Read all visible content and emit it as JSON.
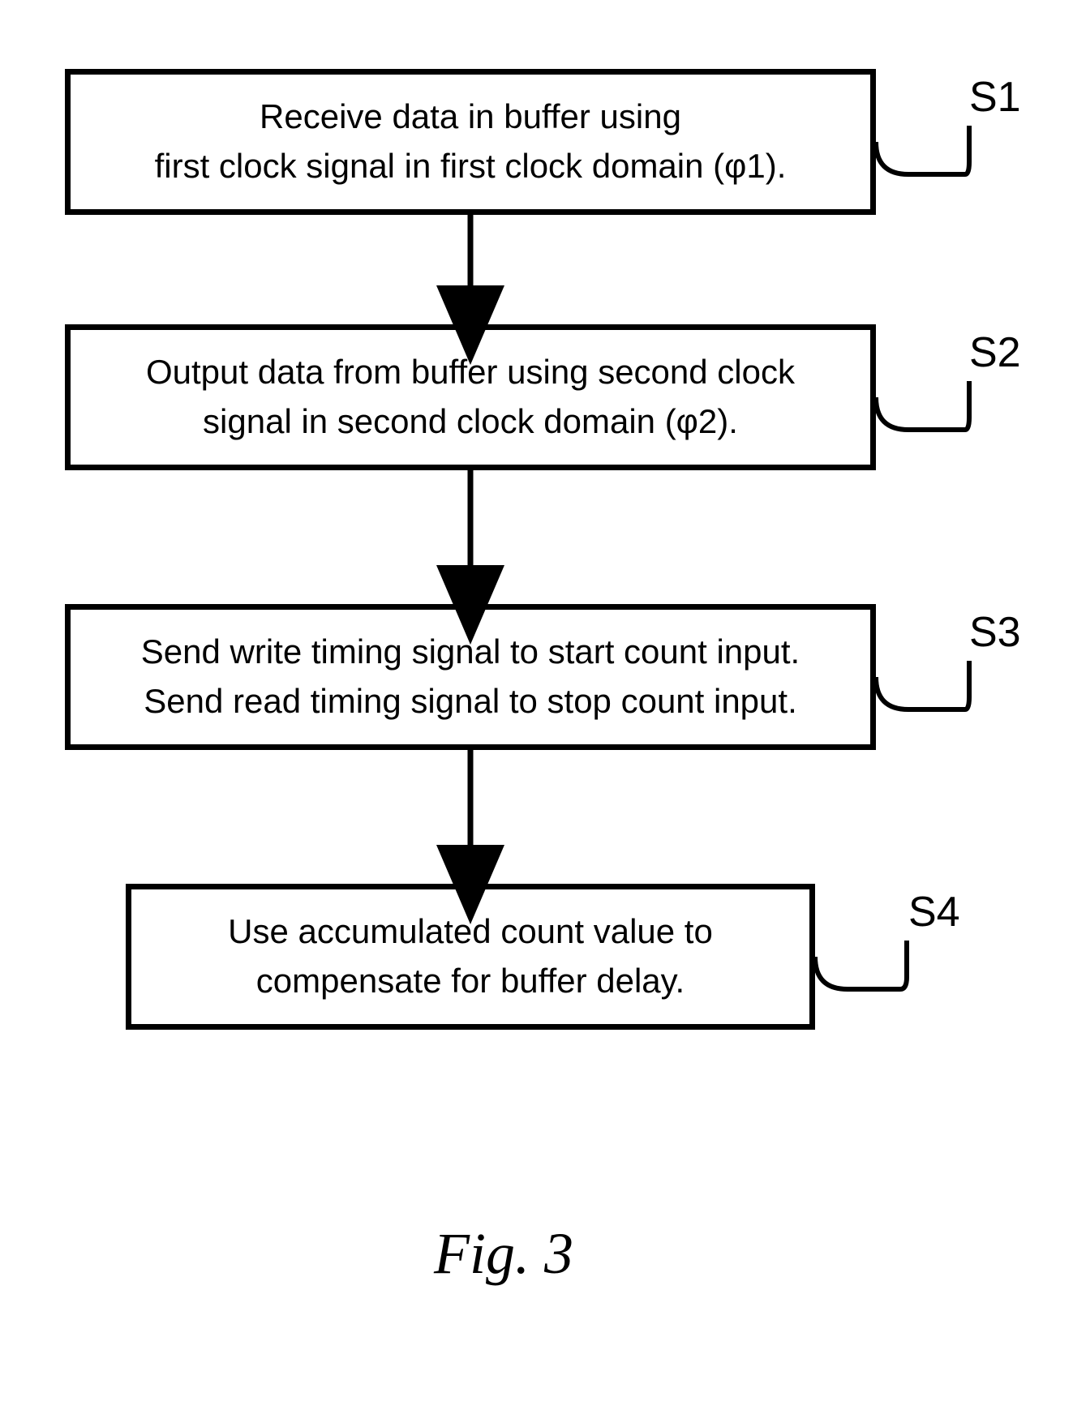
{
  "steps": [
    {
      "label": "S1",
      "text": "Receive data in buffer using\nfirst clock signal in first clock domain (φ1)."
    },
    {
      "label": "S2",
      "text": "Output data from buffer using second clock\nsignal in second clock domain (φ2)."
    },
    {
      "label": "S3",
      "text": "Send write timing signal to start count input.\nSend read timing signal to stop count input."
    },
    {
      "label": "S4",
      "text": "Use accumulated count value to\ncompensate for buffer delay."
    }
  ],
  "caption": "Fig. 3"
}
